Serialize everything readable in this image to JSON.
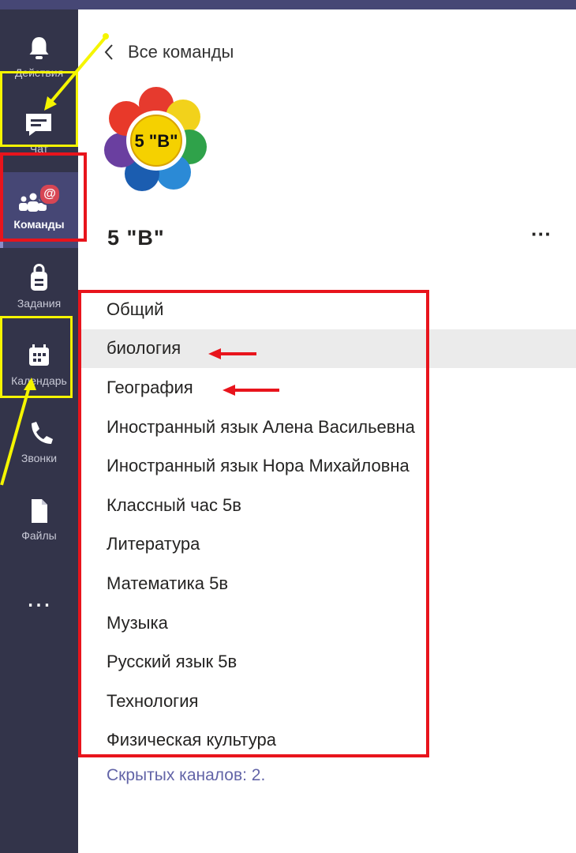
{
  "rail": {
    "items": [
      {
        "id": "activity",
        "label": "Действия",
        "icon": "bell-icon"
      },
      {
        "id": "chat",
        "label": "Чат",
        "icon": "chat-icon"
      },
      {
        "id": "teams",
        "label": "Команды",
        "icon": "teams-icon",
        "active": true,
        "badge": "@"
      },
      {
        "id": "assignments",
        "label": "Задания",
        "icon": "backpack-icon"
      },
      {
        "id": "calendar",
        "label": "Календарь",
        "icon": "calendar-icon"
      },
      {
        "id": "calls",
        "label": "Звонки",
        "icon": "phone-icon"
      },
      {
        "id": "files",
        "label": "Файлы",
        "icon": "file-icon"
      }
    ],
    "more_label": "..."
  },
  "nav": {
    "back_label": "Все команды"
  },
  "team": {
    "logo_text": "5 \"В\"",
    "name": "5 \"В\"",
    "more_label": "···"
  },
  "channels": [
    "Общий",
    "биология",
    "География",
    "Иностранный язык Алена Васильевна",
    "Иностранный язык Нора Михайловна",
    "Классный час 5в",
    "Литература",
    "Математика 5в",
    "Музыка",
    "Русский язык 5в",
    "Технология",
    "Физическая культура"
  ],
  "selected_channel": "биология",
  "hidden_channels_label": "Скрытых каналов: 2.",
  "colors": {
    "rail_bg": "#33344a",
    "rail_active": "#464775",
    "accent": "#6264a7",
    "badge": "#d74654",
    "annotation_red": "#e8141c",
    "annotation_yellow": "#f5f500"
  }
}
